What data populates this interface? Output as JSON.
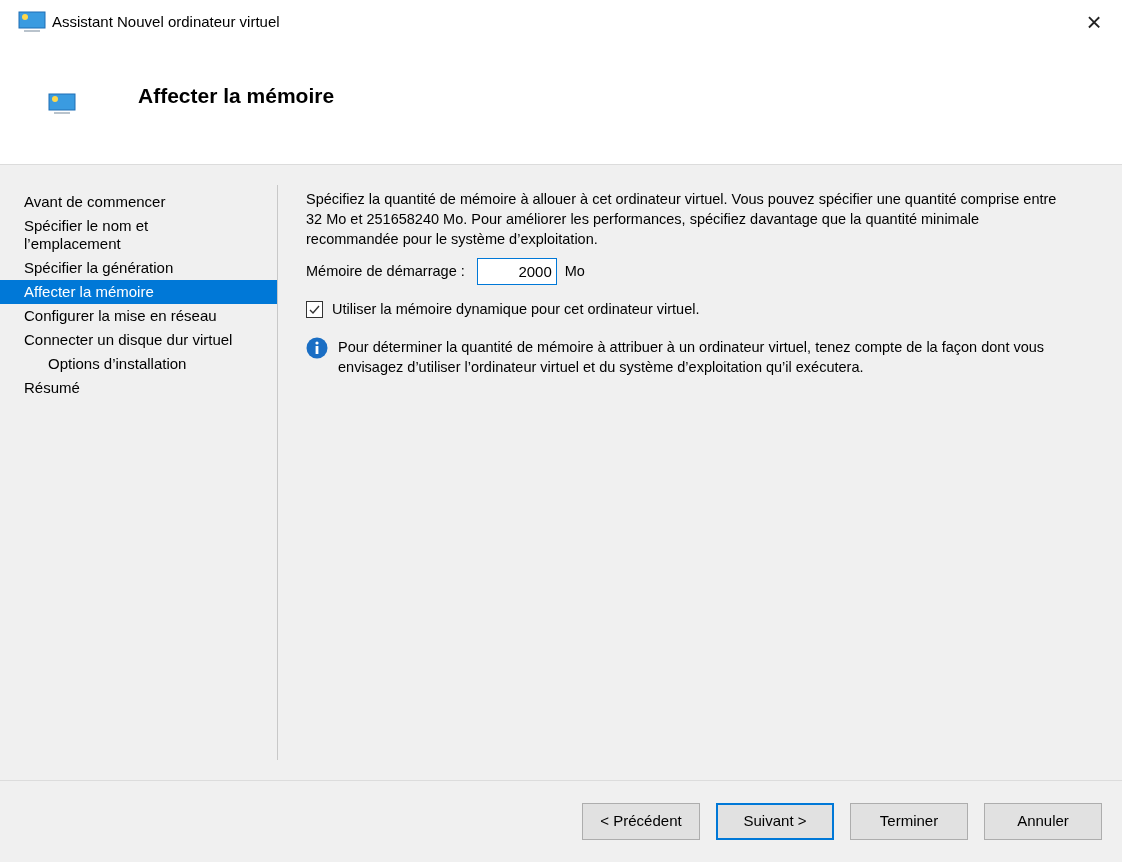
{
  "window": {
    "title": "Assistant Nouvel ordinateur virtuel",
    "close": "×"
  },
  "header": {
    "title": "Affecter la mémoire"
  },
  "sidebar": {
    "items": [
      {
        "label": "Avant de commencer",
        "selected": false
      },
      {
        "label": "Spécifier le nom et l’emplacement",
        "selected": false
      },
      {
        "label": "Spécifier la génération",
        "selected": false
      },
      {
        "label": "Affecter la mémoire",
        "selected": true
      },
      {
        "label": "Configurer la mise en réseau",
        "selected": false
      },
      {
        "label": "Connecter un disque dur virtuel",
        "selected": false,
        "children": [
          {
            "label": "Options d’installation",
            "selected": false
          }
        ]
      },
      {
        "label": "Résumé",
        "selected": false
      }
    ]
  },
  "content": {
    "description": "Spécifiez la quantité de mémoire à allouer à cet ordinateur virtuel. Vous pouvez spécifier une quantité comprise entre 32 Mo et 251658240 Mo. Pour améliorer les performances, spécifiez davantage que la quantité minimale recommandée pour le système d’exploitation.",
    "startup_memory": {
      "label": "Mémoire de démarrage :",
      "value": "2000",
      "unit": "Mo"
    },
    "dynamic_memory": {
      "label": "Utiliser la mémoire dynamique pour cet ordinateur virtuel.",
      "checked": true
    },
    "info": "Pour déterminer la quantité de mémoire à attribuer à un ordinateur virtuel, tenez compte de la façon dont vous envisagez d’utiliser l’ordinateur virtuel et du système d’exploitation qu’il exécutera."
  },
  "buttons": [
    {
      "label": "< Précédent",
      "focused": false
    },
    {
      "label": "Suivant >",
      "focused": true
    },
    {
      "label": "Terminer",
      "focused": false
    },
    {
      "label": "Annuler",
      "focused": false
    }
  ]
}
